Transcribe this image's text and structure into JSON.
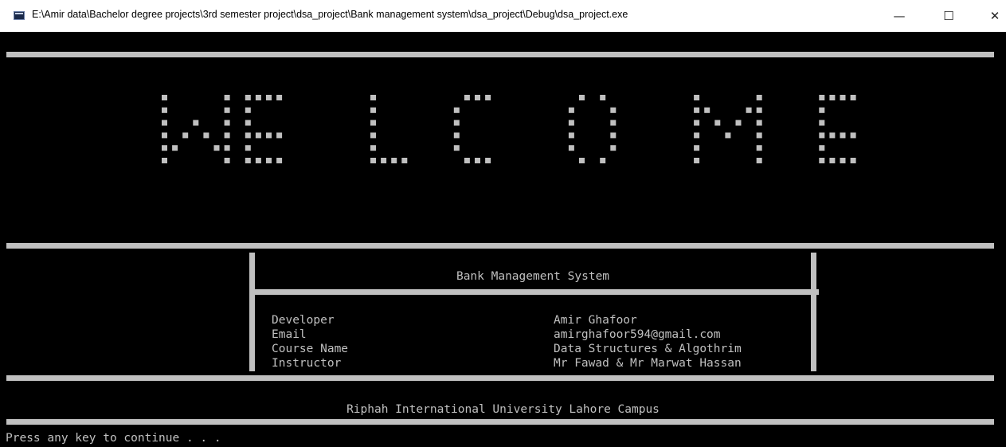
{
  "window": {
    "title": "E:\\Amir data\\Bachelor degree projects\\3rd semester project\\dsa_project\\Bank management system\\dsa_project\\Debug\\dsa_project.exe",
    "minimize_glyph": "—",
    "maximize_glyph": "☐",
    "close_glyph": "✕"
  },
  "banner": {
    "word": "WELCOME",
    "color": "#c0c0c0"
  },
  "info_box": {
    "title": "Bank Management System",
    "rows": [
      {
        "label": "Developer",
        "value": "Amir Ghafoor"
      },
      {
        "label": "Email",
        "value": "amirghafoor594@gmail.com"
      },
      {
        "label": "Course Name",
        "value": "Data Structures & Algothrim"
      },
      {
        "label": "Instructor",
        "value": "Mr Fawad & Mr Marwat Hassan"
      }
    ]
  },
  "footer": {
    "university": "Riphah International University Lahore Campus"
  },
  "prompt": {
    "text": "Press any key to continue . . ."
  },
  "colors": {
    "console_bg": "#000000",
    "console_fg": "#c0c0c0",
    "titlebar_bg": "#ffffff"
  }
}
